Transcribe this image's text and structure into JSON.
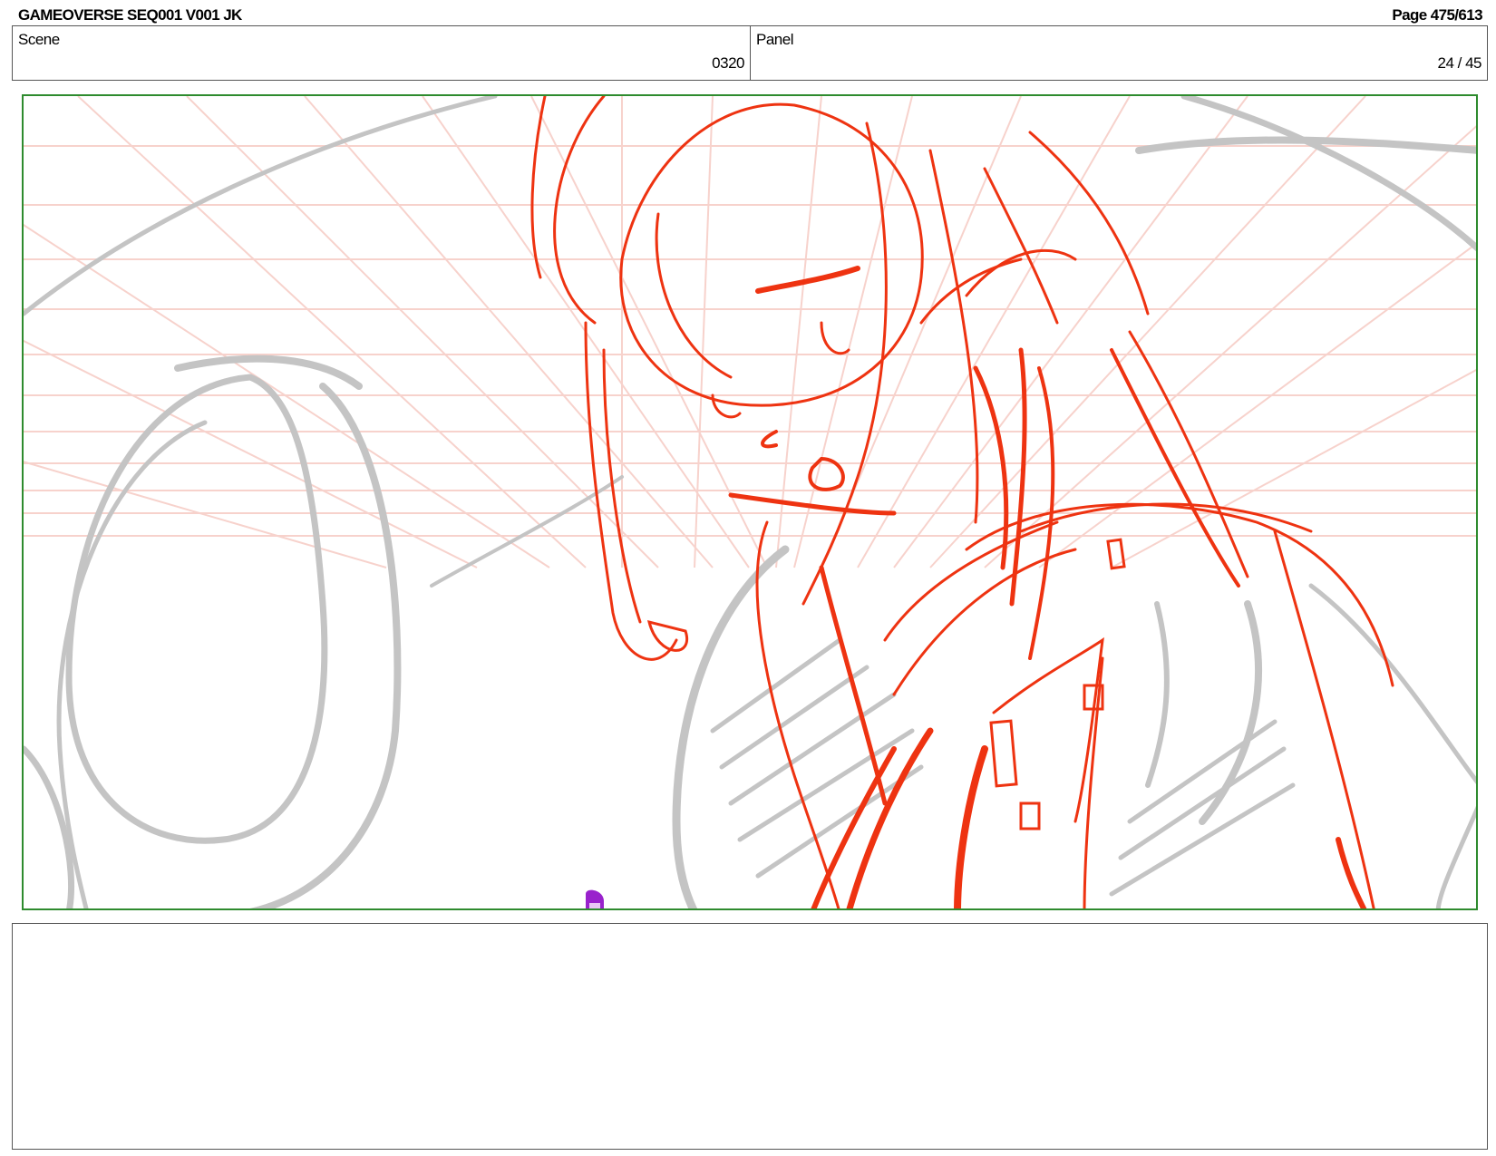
{
  "header": {
    "title": "GAMEOVERSE SEQ001 V001 JK",
    "page": "Page 475/613"
  },
  "info": {
    "scene_label": "Scene",
    "scene_value": "0320",
    "panel_label": "Panel",
    "panel_value": "24 / 45"
  },
  "colors": {
    "frame_border": "#2e8b2e",
    "sketch_red": "#ee3311",
    "sketch_gray": "#c4c4c4",
    "grid_pink": "#f7d2cc",
    "marker_purple": "#9922cc"
  }
}
